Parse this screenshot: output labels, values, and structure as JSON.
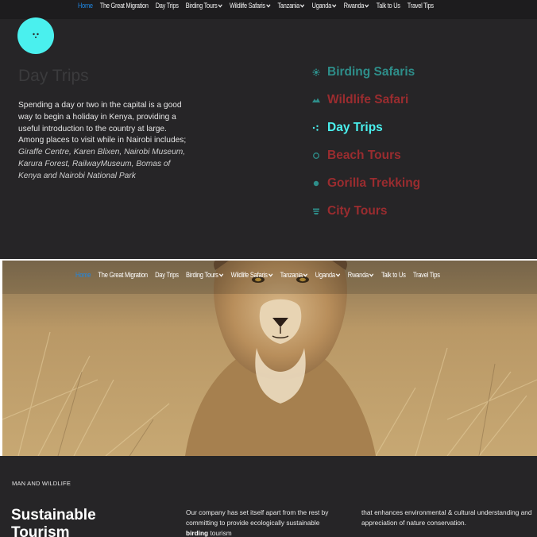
{
  "nav": {
    "items": [
      {
        "label": "Home",
        "active": true,
        "dropdown": false
      },
      {
        "label": "The Great Migration",
        "active": false,
        "dropdown": false
      },
      {
        "label": "Day Trips",
        "active": false,
        "dropdown": false
      },
      {
        "label": "Birding Tours",
        "active": false,
        "dropdown": true
      },
      {
        "label": "Wildlife Safaris",
        "active": false,
        "dropdown": true
      },
      {
        "label": "Tanzania",
        "active": false,
        "dropdown": true
      },
      {
        "label": "Uganda",
        "active": false,
        "dropdown": true
      },
      {
        "label": "Rwanda",
        "active": false,
        "dropdown": true
      },
      {
        "label": "Talk to Us",
        "active": false,
        "dropdown": false
      },
      {
        "label": "Travel Tips",
        "active": false,
        "dropdown": false
      }
    ]
  },
  "day_trips": {
    "title": "Day Trips",
    "intro": "Spending a day or two in the capital is a good way to begin a holiday in Kenya, providing a useful introduction to the country at large. Among places to visit while in Nairobi includes;",
    "places": "Giraffe Centre, Karen Blixen, Nairobi Museum, Karura Forest, RailwayMuseum, Bomas of Kenya and Nairobi National Park"
  },
  "side_menu": {
    "items": [
      {
        "label": "Birding Safaris",
        "icon": "bird-icon",
        "color": "#2e8e8a",
        "active": false
      },
      {
        "label": "Wildlife Safari",
        "icon": "mountain-icon",
        "color": "#9a2c2f",
        "active": false
      },
      {
        "label": "Day Trips",
        "icon": "dots-icon",
        "color": "#4af0ee",
        "active": true
      },
      {
        "label": "Beach Tours",
        "icon": "circle-icon",
        "color": "#9a2c2f",
        "active": false
      },
      {
        "label": "Gorilla Trekking",
        "icon": "dot-icon",
        "color": "#9a2c2f",
        "active": false
      },
      {
        "label": "City Tours",
        "icon": "layers-icon",
        "color": "#9a2c2f",
        "active": false
      }
    ]
  },
  "about": {
    "eyebrow": "MAN AND WILDLIFE",
    "title": "Sustainable Tourism",
    "col1_text": "Our company has set itself apart from the rest by committing to provide ecologically sustainable",
    "col1_bold": "birding",
    "col1_tail": "tourism",
    "col2_text": "that enhances environmental & cultural understanding and appreciation of nature conservation."
  },
  "colors": {
    "background": "#262527",
    "accent": "#4af0ee",
    "teal": "#2e8e8a",
    "red": "#9a2c2f",
    "nav_active": "#1e88e5"
  }
}
